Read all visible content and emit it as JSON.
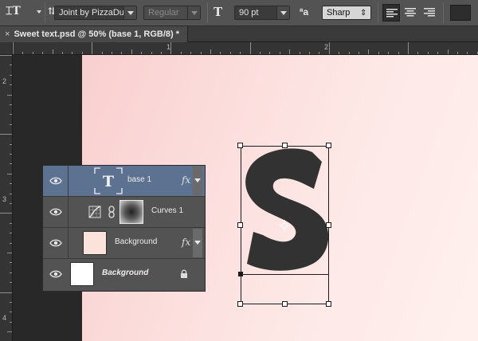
{
  "options_bar": {
    "tool_icon": "text-orientation-icon",
    "font_family": "Joint by PizzaDu...",
    "font_style": "Regular",
    "font_size_icon": "font-size-icon",
    "font_size": "90 pt",
    "antialias_icon": "antialias-icon",
    "antialias": "Sharp",
    "align_left_icon": "align-left-icon",
    "align_center_icon": "align-center-icon",
    "align_right_icon": "align-right-icon",
    "text_color": "#2d2d2d"
  },
  "document_tab": {
    "close_symbol": "×",
    "title": "Sweet text.psd @ 50% (base 1, RGB/8) *"
  },
  "rulers": {
    "top_labels": [
      "1",
      "2"
    ],
    "left_labels": [
      "2",
      "3",
      "4"
    ]
  },
  "layers_panel": {
    "layers": [
      {
        "name": "base 1",
        "thumb": "T",
        "fx": "fx",
        "selected": true
      },
      {
        "name": "Curves 1",
        "type": "adjustment"
      },
      {
        "name": "Background",
        "fx": "fx"
      },
      {
        "name": "Background",
        "locked": true
      }
    ]
  },
  "colors": {
    "selected_layer": "#5d7291",
    "panel": "#535353",
    "canvas_start": "#f9cfcf",
    "canvas_end": "#fff0ee"
  }
}
